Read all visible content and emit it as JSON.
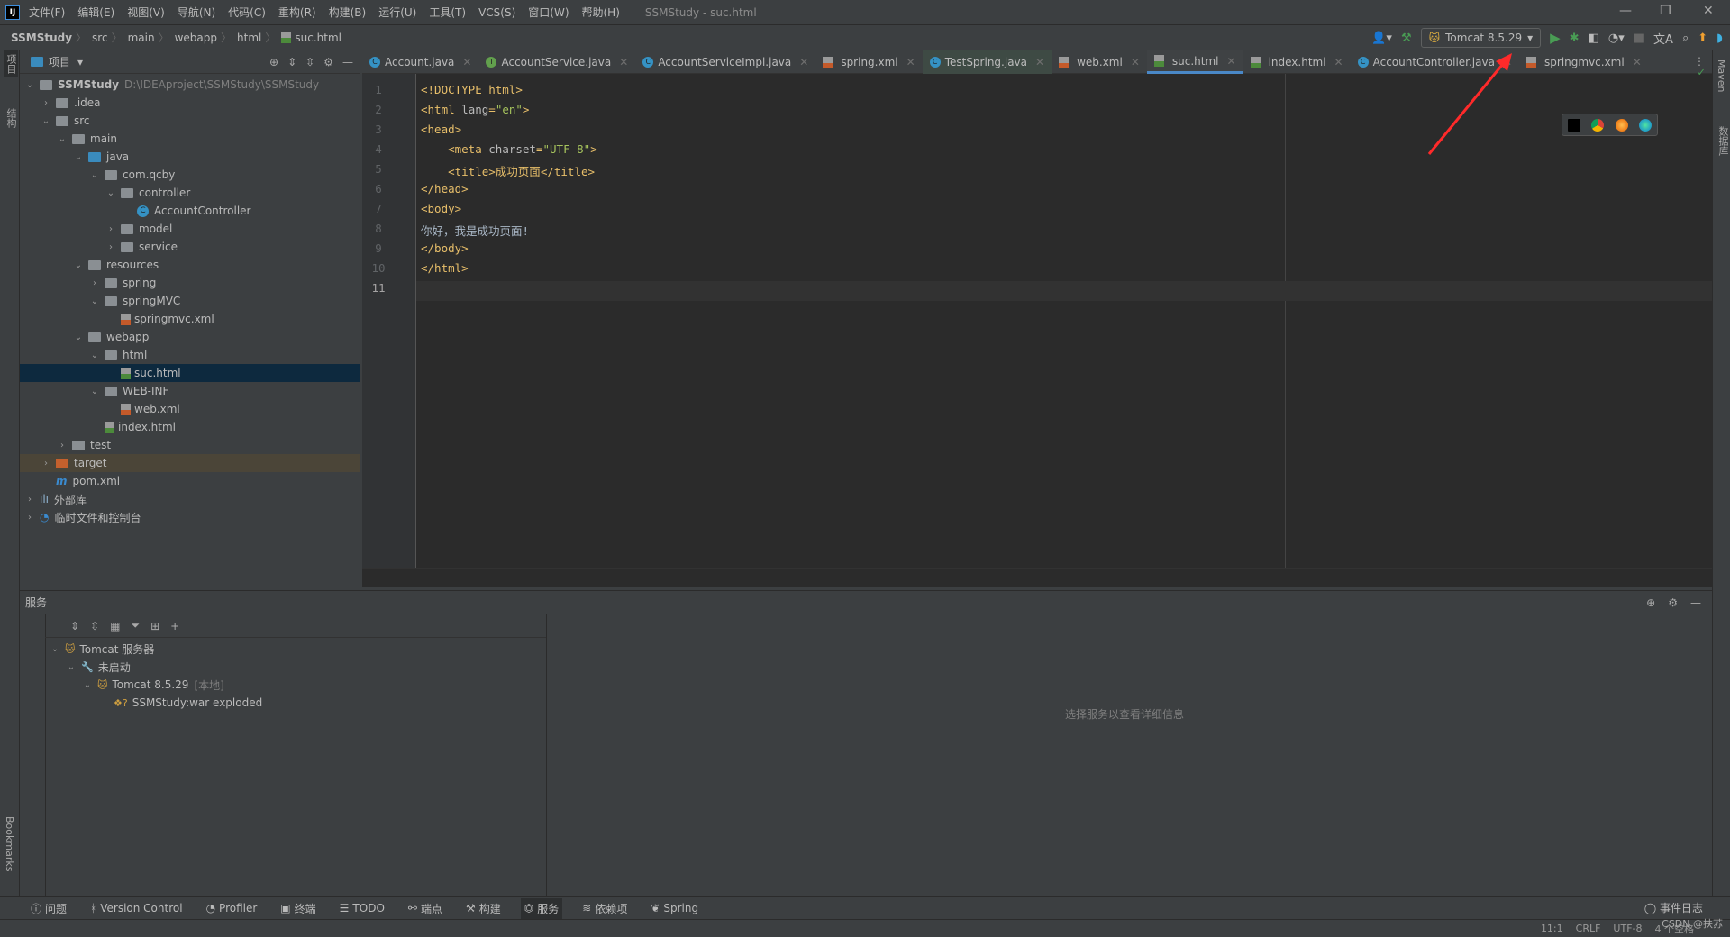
{
  "app": {
    "title": "SSMStudy - suc.html",
    "logo": "IJ"
  },
  "menu": [
    "文件(F)",
    "编辑(E)",
    "视图(V)",
    "导航(N)",
    "代码(C)",
    "重构(R)",
    "构建(B)",
    "运行(U)",
    "工具(T)",
    "VCS(S)",
    "窗口(W)",
    "帮助(H)"
  ],
  "breadcrumb": [
    "SSMStudy",
    "src",
    "main",
    "webapp",
    "html",
    "suc.html"
  ],
  "run": {
    "config": "Tomcat 8.5.29",
    "run_color": "#499c54"
  },
  "left_stripe": {
    "project": "项目",
    "structure": "结构",
    "bookmarks": "Bookmarks"
  },
  "right_stripe": {
    "maven": "Maven",
    "database": "数据库"
  },
  "project": {
    "header": "项目",
    "tree": [
      {
        "label": "SSMStudy",
        "path": "D:\\IDEAproject\\SSMStudy\\SSMStudy",
        "depth": 0,
        "arrow": "down",
        "icon": "module"
      },
      {
        "label": ".idea",
        "depth": 1,
        "arrow": "right",
        "icon": "folder"
      },
      {
        "label": "src",
        "depth": 1,
        "arrow": "down",
        "icon": "folder"
      },
      {
        "label": "main",
        "depth": 2,
        "arrow": "down",
        "icon": "folder"
      },
      {
        "label": "java",
        "depth": 3,
        "arrow": "down",
        "icon": "folder-blue"
      },
      {
        "label": "com.qcby",
        "depth": 4,
        "arrow": "down",
        "icon": "package"
      },
      {
        "label": "controller",
        "depth": 5,
        "arrow": "down",
        "icon": "package"
      },
      {
        "label": "AccountController",
        "depth": 6,
        "arrow": "",
        "icon": "class"
      },
      {
        "label": "model",
        "depth": 5,
        "arrow": "right",
        "icon": "package"
      },
      {
        "label": "service",
        "depth": 5,
        "arrow": "right",
        "icon": "package"
      },
      {
        "label": "resources",
        "depth": 3,
        "arrow": "down",
        "icon": "folder"
      },
      {
        "label": "spring",
        "depth": 4,
        "arrow": "right",
        "icon": "folder"
      },
      {
        "label": "springMVC",
        "depth": 4,
        "arrow": "down",
        "icon": "folder"
      },
      {
        "label": "springmvc.xml",
        "depth": 5,
        "arrow": "",
        "icon": "xml"
      },
      {
        "label": "webapp",
        "depth": 3,
        "arrow": "down",
        "icon": "folder"
      },
      {
        "label": "html",
        "depth": 4,
        "arrow": "down",
        "icon": "folder"
      },
      {
        "label": "suc.html",
        "depth": 5,
        "arrow": "",
        "icon": "html",
        "selected": true
      },
      {
        "label": "WEB-INF",
        "depth": 4,
        "arrow": "down",
        "icon": "folder"
      },
      {
        "label": "web.xml",
        "depth": 5,
        "arrow": "",
        "icon": "xml"
      },
      {
        "label": "index.html",
        "depth": 4,
        "arrow": "",
        "icon": "html"
      },
      {
        "label": "test",
        "depth": 2,
        "arrow": "right",
        "icon": "folder"
      },
      {
        "label": "target",
        "depth": 1,
        "arrow": "right",
        "icon": "folder-orange",
        "target": true
      },
      {
        "label": "pom.xml",
        "depth": 1,
        "arrow": "",
        "icon": "maven"
      },
      {
        "label": "外部库",
        "depth": 0,
        "arrow": "right",
        "icon": "library"
      },
      {
        "label": "临时文件和控制台",
        "depth": 0,
        "arrow": "right",
        "icon": "scratch"
      }
    ]
  },
  "tabs": [
    {
      "label": "Account.java",
      "icon": "C"
    },
    {
      "label": "AccountService.java",
      "icon": "I"
    },
    {
      "label": "AccountServiceImpl.java",
      "icon": "C"
    },
    {
      "label": "spring.xml",
      "icon": "xml"
    },
    {
      "label": "TestSpring.java",
      "icon": "C",
      "dim": true
    },
    {
      "label": "web.xml",
      "icon": "xml"
    },
    {
      "label": "suc.html",
      "icon": "html",
      "active": true
    },
    {
      "label": "index.html",
      "icon": "html"
    },
    {
      "label": "AccountController.java",
      "icon": "C"
    },
    {
      "label": "springmvc.xml",
      "icon": "xml"
    }
  ],
  "editor": {
    "current_line": 11,
    "lines": [
      "<!DOCTYPE html>",
      "<html lang=\"en\">",
      "<head>",
      "    <meta charset=\"UTF-8\">",
      "    <title>成功页面</title>",
      "</head>",
      "<body>",
      "你好，我是成功页面!",
      "</body>",
      "</html>",
      ""
    ]
  },
  "services": {
    "title": "服务",
    "detail_placeholder": "选择服务以查看详细信息",
    "tree": [
      {
        "label": "Tomcat 服务器",
        "depth": 0
      },
      {
        "label": "未启动",
        "depth": 1
      },
      {
        "label": "Tomcat 8.5.29",
        "suffix": "[本地]",
        "depth": 2
      },
      {
        "label": "SSMStudy:war exploded",
        "depth": 3
      }
    ]
  },
  "bottom_tools": [
    {
      "label": "问题",
      "icon": "info"
    },
    {
      "label": "Version Control",
      "icon": "branch"
    },
    {
      "label": "Profiler",
      "icon": "profiler"
    },
    {
      "label": "终端",
      "icon": "terminal"
    },
    {
      "label": "TODO",
      "icon": "list"
    },
    {
      "label": "端点",
      "icon": "endpoints"
    },
    {
      "label": "构建",
      "icon": "hammer"
    },
    {
      "label": "服务",
      "icon": "services",
      "active": true
    },
    {
      "label": "依赖项",
      "icon": "layers"
    },
    {
      "label": "Spring",
      "icon": "leaf"
    }
  ],
  "status": {
    "event_log": "事件日志",
    "position": "11:1",
    "line_sep": "CRLF",
    "encoding": "UTF-8",
    "indent": "4 个空格",
    "watermark": "CSDN @扶苏"
  }
}
